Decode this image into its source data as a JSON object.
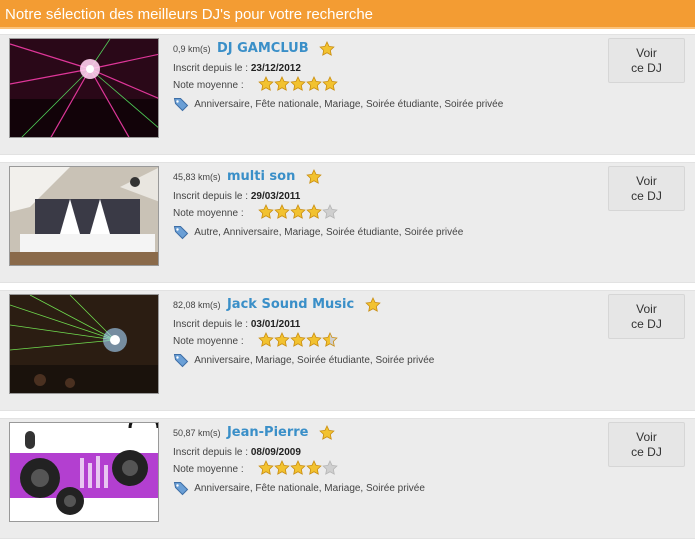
{
  "header": {
    "title": "Notre sélection des meilleurs DJ's pour votre recherche"
  },
  "labels": {
    "registered": "Inscrit depuis le :",
    "rating": "Note moyenne :",
    "button_line1": "Voir",
    "button_line2": "ce DJ"
  },
  "colors": {
    "header_bg": "#f39c33",
    "name_link": "#3a8fc8",
    "star_fill": "#f2c230",
    "star_empty": "#cfcfcf"
  },
  "djs": [
    {
      "distance": "0,9 km(s)",
      "name": "DJ GAMCLUB",
      "registered_date": "23/12/2012",
      "rating": 5,
      "tags": "Anniversaire, Fête nationale, Mariage, Soirée étudiante, Soirée privée",
      "thumbnail": "club-lasers-pink"
    },
    {
      "distance": "45,83 km(s)",
      "name": "multi son",
      "registered_date": "29/03/2011",
      "rating": 4,
      "tags": "Autre, Anniversaire, Mariage, Soirée étudiante, Soirée privée",
      "thumbnail": "hall-stage-setup"
    },
    {
      "distance": "82,08 km(s)",
      "name": "Jack Sound Music",
      "registered_date": "03/01/2011",
      "rating": 4.5,
      "tags": "Anniversaire, Mariage, Soirée étudiante, Soirée privée",
      "thumbnail": "green-lasers-stage"
    },
    {
      "distance": "50,87 km(s)",
      "name": "Jean-Pierre",
      "registered_date": "08/09/2009",
      "rating": 4,
      "tags": "Anniversaire, Fête nationale, Mariage, Soirée privée",
      "thumbnail": "speakers-purple-graphic"
    }
  ]
}
